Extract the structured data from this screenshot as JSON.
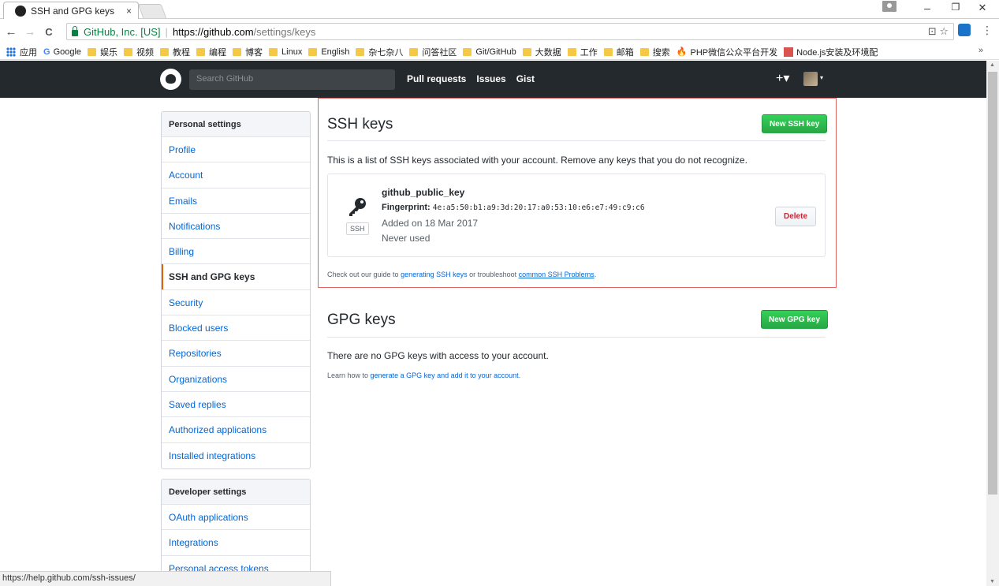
{
  "browser": {
    "tab_title": "SSH and GPG keys",
    "tab_close": "×",
    "nav_back": "←",
    "nav_forward": "→",
    "nav_reload": "C",
    "secure_org": "GitHub, Inc. [US]",
    "url_separator": "|",
    "url_host": "https://github.com",
    "url_path": "/settings/keys",
    "omnibox_right": "⊡ ☆",
    "menu_dots": "⋮",
    "window_minimize": "–",
    "window_restore": "❐",
    "window_close": "✕"
  },
  "bookmarks": {
    "apps_label": "应用",
    "items": [
      "Google",
      "娱乐",
      "视频",
      "教程",
      "编程",
      "博客",
      "Linux",
      "English",
      "杂七杂八",
      "问答社区",
      "Git/GitHub",
      "大数据",
      "工作",
      "邮箱",
      "搜索",
      "PHP微信公众平台开发",
      "Node.js安装及环境配"
    ],
    "more": "»"
  },
  "gh_header": {
    "search_placeholder": "Search GitHub",
    "nav": [
      "Pull requests",
      "Issues",
      "Gist"
    ],
    "plus": "+▾",
    "avatar_caret": "▾"
  },
  "sidebar": {
    "personal": {
      "heading": "Personal settings",
      "items": [
        "Profile",
        "Account",
        "Emails",
        "Notifications",
        "Billing",
        "SSH and GPG keys",
        "Security",
        "Blocked users",
        "Repositories",
        "Organizations",
        "Saved replies",
        "Authorized applications",
        "Installed integrations"
      ],
      "selected": "SSH and GPG keys"
    },
    "developer": {
      "heading": "Developer settings",
      "items": [
        "OAuth applications",
        "Integrations",
        "Personal access tokens"
      ]
    }
  },
  "ssh": {
    "title": "SSH keys",
    "new_button": "New SSH key",
    "description": "This is a list of SSH keys associated with your account. Remove any keys that you do not recognize.",
    "key": {
      "name": "github_public_key",
      "fingerprint_label": "Fingerprint:",
      "fingerprint": "4e:a5:50:b1:a9:3d:20:17:a0:53:10:e6:e7:49:c9:c6",
      "type_label": "SSH",
      "added": "Added on 18 Mar 2017",
      "used": "Never used",
      "delete_button": "Delete"
    },
    "guide_prefix": "Check out our guide to ",
    "guide_link1": "generating SSH keys",
    "guide_mid": " or troubleshoot ",
    "guide_link2": "common SSH Problems",
    "guide_suffix": "."
  },
  "gpg": {
    "title": "GPG keys",
    "new_button": "New GPG key",
    "empty_text": "There are no GPG keys with access to your account.",
    "learn_prefix": "Learn how to ",
    "learn_link": "generate a GPG key and add it to your account",
    "learn_suffix": "."
  },
  "statusbar": {
    "url": "https://help.github.com/ssh-issues/"
  },
  "colors": {
    "header_bg": "#24292e",
    "link": "#0366d6",
    "green_button": "#28a745",
    "danger": "#cb2431",
    "selected_marker": "#e36209",
    "highlight_outline": "#e06666"
  }
}
